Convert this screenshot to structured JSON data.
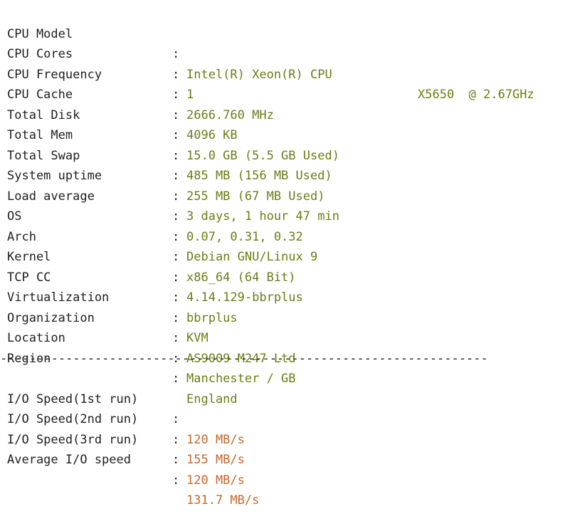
{
  "colors": {
    "label": "#1e1e1e",
    "value_green": "#6b7d16",
    "value_orange": "#c8672a",
    "background": "#ffffff"
  },
  "separator": ":",
  "system_info": [
    {
      "label": "CPU Model",
      "value": "Intel(R) Xeon(R) CPU",
      "extra": "X5650  @ 2.67GHz"
    },
    {
      "label": "CPU Cores",
      "value": "1"
    },
    {
      "label": "CPU Frequency",
      "value": "2666.760 MHz"
    },
    {
      "label": "CPU Cache",
      "value": "4096 KB"
    },
    {
      "label": "Total Disk",
      "value": "15.0 GB (5.5 GB Used)"
    },
    {
      "label": "Total Mem",
      "value": "485 MB (156 MB Used)"
    },
    {
      "label": "Total Swap",
      "value": "255 MB (67 MB Used)"
    },
    {
      "label": "System uptime",
      "value": "3 days, 1 hour 47 min"
    },
    {
      "label": "Load average",
      "value": "0.07, 0.31, 0.32"
    },
    {
      "label": "OS",
      "value": "Debian GNU/Linux 9"
    },
    {
      "label": "Arch",
      "value": "x86_64 (64 Bit)"
    },
    {
      "label": "Kernel",
      "value": "4.14.129-bbrplus"
    },
    {
      "label": "TCP CC",
      "value": "bbrplus"
    },
    {
      "label": "Virtualization",
      "value": "KVM"
    },
    {
      "label": "Organization",
      "value": "AS9009 M247 Ltd"
    },
    {
      "label": "Location",
      "value": "Manchester / GB"
    },
    {
      "label": "Region",
      "value": "England"
    }
  ],
  "divider": "-------------------------------------------------------------------",
  "io_results": [
    {
      "label": "I/O Speed(1st run)",
      "value": "120 MB/s"
    },
    {
      "label": "I/O Speed(2nd run)",
      "value": "155 MB/s"
    },
    {
      "label": "I/O Speed(3rd run)",
      "value": "120 MB/s"
    },
    {
      "label": "Average I/O speed",
      "value": "131.7 MB/s"
    }
  ]
}
